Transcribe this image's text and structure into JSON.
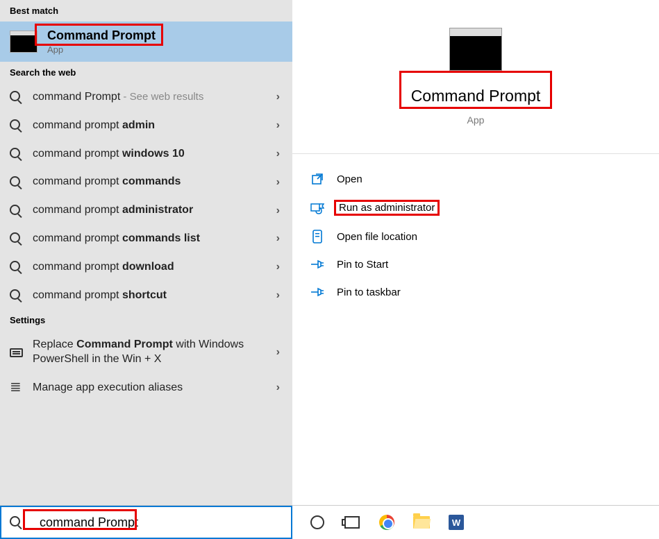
{
  "sections": {
    "best_match": "Best match",
    "search_web": "Search the web",
    "settings": "Settings"
  },
  "best_match_item": {
    "title": "Command Prompt",
    "subtitle": "App"
  },
  "web_results": [
    {
      "prefix": "command Prompt",
      "bold": "",
      "suffix": " - See web results"
    },
    {
      "prefix": "command prompt ",
      "bold": "admin",
      "suffix": ""
    },
    {
      "prefix": "command prompt ",
      "bold": "windows 10",
      "suffix": ""
    },
    {
      "prefix": "command prompt ",
      "bold": "commands",
      "suffix": ""
    },
    {
      "prefix": "command prompt ",
      "bold": "administrator",
      "suffix": ""
    },
    {
      "prefix": "command prompt ",
      "bold": "commands list",
      "suffix": ""
    },
    {
      "prefix": "command prompt ",
      "bold": "download",
      "suffix": ""
    },
    {
      "prefix": "command prompt ",
      "bold": "shortcut",
      "suffix": ""
    }
  ],
  "settings_results": [
    {
      "text_pre": "Replace ",
      "text_bold": "Command Prompt",
      "text_post": " with Windows PowerShell in the Win + X"
    },
    {
      "text_pre": "Manage app execution aliases",
      "text_bold": "",
      "text_post": ""
    }
  ],
  "preview": {
    "title": "Command Prompt",
    "subtitle": "App"
  },
  "actions": [
    {
      "icon": "open",
      "label": "Open"
    },
    {
      "icon": "admin",
      "label": "Run as administrator"
    },
    {
      "icon": "location",
      "label": "Open file location"
    },
    {
      "icon": "pin-start",
      "label": "Pin to Start"
    },
    {
      "icon": "pin-taskbar",
      "label": "Pin to taskbar"
    }
  ],
  "search_value": "command Prompt",
  "word_letter": "W"
}
